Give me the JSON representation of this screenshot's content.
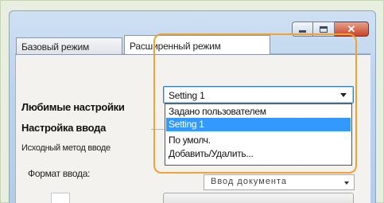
{
  "window": {
    "buttons": {
      "minimize": "minimize",
      "maximize": "maximize",
      "close": "close"
    }
  },
  "tabs": [
    {
      "label": "Базовый режим",
      "active": false
    },
    {
      "label": "Расширенный режим",
      "active": true
    }
  ],
  "favorites": {
    "label": "Любимые настройки",
    "selected_value": "Setting 1",
    "options": [
      "Задано пользователем",
      "Setting 1",
      "По умолч.",
      "Добавить/Удалить..."
    ],
    "selected_index": 1
  },
  "input_settings": {
    "heading": "Настройка ввода",
    "input_method_label": "Исходный метод вводе",
    "input_format_label": "Формат ввода:",
    "input_format_value": "Ввод документа"
  },
  "colors": {
    "highlight": "#f0a232",
    "selection": "#3399ff"
  }
}
